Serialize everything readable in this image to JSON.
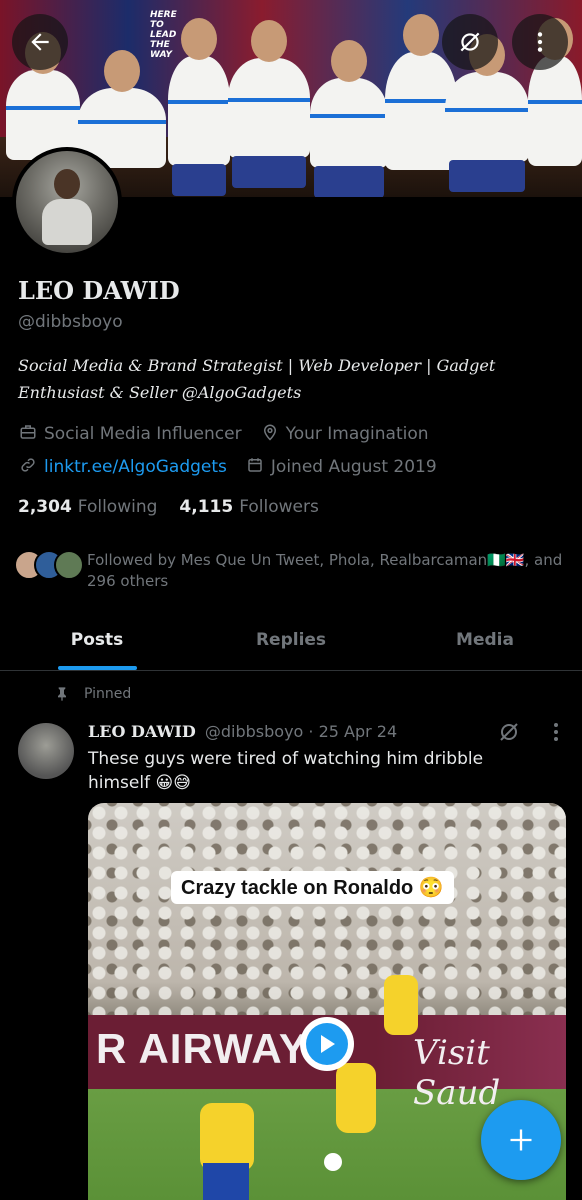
{
  "banner": {
    "slogan": "HERE TO LEAD THE WAY"
  },
  "profile": {
    "name": "LEO DAWID",
    "handle": "@dibbsboyo",
    "bio": "Social Media & Brand Strategist | Web Developer | Gadget Enthusiast & Seller @AlgoGadgets",
    "category": "Social Media Influencer",
    "location": "Your Imagination",
    "website": "linktr.ee/AlgoGadgets",
    "joined": "Joined August 2019",
    "following_count": "2,304",
    "following_label": "Following",
    "followers_count": "4,115",
    "followers_label": "Followers",
    "followed_by": "Followed by Mes Que Un Tweet, Phola, Realbarcaman🇳🇬🇬🇧, and 296 others"
  },
  "tabs": [
    {
      "label": "Posts"
    },
    {
      "label": "Replies"
    },
    {
      "label": "Media"
    }
  ],
  "tweet": {
    "pinned_label": "Pinned",
    "name": "LEO DAWID",
    "handle": "@dibbsboyo",
    "date": "· 25 Apr 24",
    "text": "These guys were tired of watching him dribble himself 😀😅",
    "media_caption": "Crazy tackle on Ronaldo 😳",
    "board_text_1": "R AIRWAYS",
    "board_text_2": "Visit Saud"
  },
  "colors": {
    "accent": "#1d9bf0",
    "background": "#000000",
    "muted": "#71767b"
  }
}
